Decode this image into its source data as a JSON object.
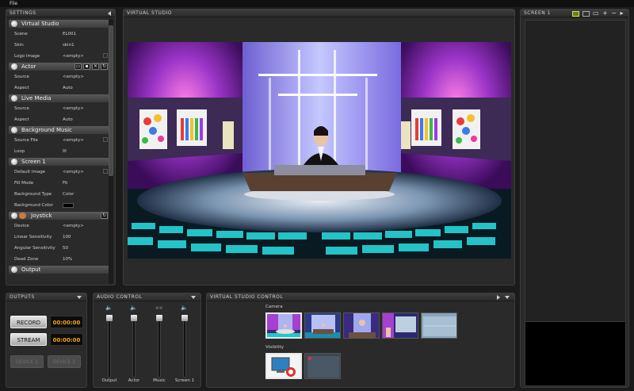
{
  "menubar": {
    "file": "File"
  },
  "settings": {
    "title": "SETTINGS",
    "sections": {
      "virtual_studio": {
        "label": "Virtual Studio",
        "rows": [
          {
            "label": "Scene",
            "value": "EL001"
          },
          {
            "label": "Skin",
            "value": "skin1"
          },
          {
            "label": "Logo Image",
            "value": "<empty>"
          }
        ]
      },
      "actor": {
        "label": "Actor",
        "rows": [
          {
            "label": "Source",
            "value": "<empty>"
          },
          {
            "label": "Aspect",
            "value": "Auto"
          }
        ]
      },
      "live_media": {
        "label": "Live Media",
        "rows": [
          {
            "label": "Source",
            "value": "<empty>"
          },
          {
            "label": "Aspect",
            "value": "Auto"
          }
        ]
      },
      "background_music": {
        "label": "Background Music",
        "rows": [
          {
            "label": "Source File",
            "value": "<empty>"
          },
          {
            "label": "Loop",
            "value": "☒"
          }
        ]
      },
      "screen1": {
        "label": "Screen 1",
        "rows": [
          {
            "label": "Default Image",
            "value": "<empty>"
          },
          {
            "label": "Fill Mode",
            "value": "Fit"
          },
          {
            "label": "Background Type",
            "value": "Color"
          },
          {
            "label": "Background Color",
            "value": ""
          }
        ],
        "background_color": "#000000"
      },
      "joystick": {
        "label": "Joystick",
        "rows": [
          {
            "label": "Device",
            "value": "<empty>"
          },
          {
            "label": "Linear Sensitivity",
            "value": "100"
          },
          {
            "label": "Angular Sensitivity",
            "value": "50"
          },
          {
            "label": "Dead Zone",
            "value": "10%"
          }
        ]
      },
      "output": {
        "label": "Output"
      }
    }
  },
  "virtual_studio": {
    "title": "VIRTUAL STUDIO"
  },
  "screen1": {
    "title": "SCREEN 1"
  },
  "outputs": {
    "title": "OUTPUTS",
    "record_label": "RECORD",
    "record_time": "00:00:00",
    "stream_label": "STREAM",
    "stream_time": "00:00:00",
    "device1_label": "DEVICE 1",
    "device2_label": "DEVICE 2"
  },
  "audio": {
    "title": "AUDIO CONTROL",
    "channels": [
      {
        "label": "Output",
        "level": 1.0
      },
      {
        "label": "Actor",
        "level": 1.0
      },
      {
        "label": "Music",
        "level": 1.0
      },
      {
        "label": "Screen 1",
        "level": 1.0
      }
    ]
  },
  "vs_control": {
    "title": "VIRTUAL STUDIO CONTROL",
    "camera_label": "Camera",
    "visibility_label": "Visibility"
  },
  "colors": {
    "accent_time": "#f3a21a",
    "active_icon": "#6d7d18"
  }
}
